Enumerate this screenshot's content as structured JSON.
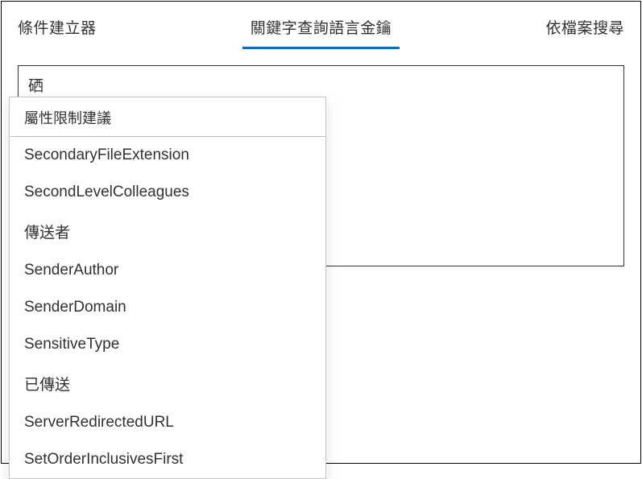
{
  "tabs": {
    "conditionBuilder": "條件建立器",
    "kqlHint": "關鍵字查詢語言金鑰",
    "searchByFile": "依檔案搜尋"
  },
  "query": {
    "value": "硒"
  },
  "suggestions": {
    "header": "屬性限制建議",
    "items": [
      "SecondaryFileExtension",
      "SecondLevelColleagues",
      "傳送者",
      "SenderAuthor",
      "SenderDomain",
      "SensitiveType",
      "已傳送",
      "ServerRedirectedURL",
      "SetOrderInclusivesFirst"
    ]
  }
}
